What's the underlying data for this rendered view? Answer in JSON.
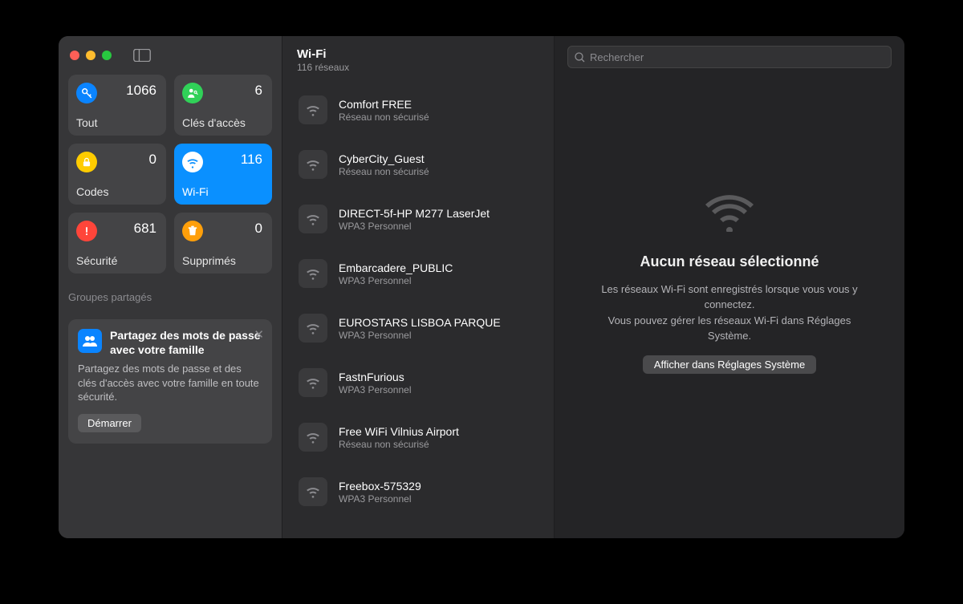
{
  "sidebar": {
    "categories": [
      {
        "label": "Tout",
        "count": "1066",
        "icon": "key",
        "color": "#0a84ff"
      },
      {
        "label": "Clés d'accès",
        "count": "6",
        "icon": "person-key",
        "color": "#30d158"
      },
      {
        "label": "Codes",
        "count": "0",
        "icon": "lock",
        "color": "#ffcc00"
      },
      {
        "label": "Wi-Fi",
        "count": "116",
        "icon": "wifi",
        "color": "#ffffff",
        "selected": true
      },
      {
        "label": "Sécurité",
        "count": "681",
        "icon": "alert",
        "color": "#ff453a"
      },
      {
        "label": "Supprimés",
        "count": "0",
        "icon": "trash",
        "color": "#ff9f0a"
      }
    ],
    "shared_section_label": "Groupes partagés",
    "share_card": {
      "title": "Partagez des mots de passe avec votre famille",
      "body": "Partagez des mots de passe et des clés d'accès avec votre famille en toute sécurité.",
      "button": "Démarrer"
    }
  },
  "middle": {
    "title": "Wi-Fi",
    "subtitle": "116 réseaux",
    "networks": [
      {
        "name": "Comfort FREE",
        "security": "Réseau non sécurisé"
      },
      {
        "name": "CyberCity_Guest",
        "security": "Réseau non sécurisé"
      },
      {
        "name": "DIRECT-5f-HP M277 LaserJet",
        "security": "WPA3 Personnel"
      },
      {
        "name": "Embarcadere_PUBLIC",
        "security": "WPA3 Personnel"
      },
      {
        "name": "EUROSTARS LISBOA PARQUE",
        "security": "WPA3 Personnel"
      },
      {
        "name": "FastnFurious",
        "security": "WPA3 Personnel"
      },
      {
        "name": "Free WiFi Vilnius Airport",
        "security": "Réseau non sécurisé"
      },
      {
        "name": "Freebox-575329",
        "security": "WPA3 Personnel"
      }
    ]
  },
  "detail": {
    "search_placeholder": "Rechercher",
    "title": "Aucun réseau sélectionné",
    "line1": "Les réseaux Wi-Fi sont enregistrés lorsque vous vous y connectez.",
    "line2": "Vous pouvez gérer les réseaux Wi-Fi dans Réglages Système.",
    "button": "Afficher dans Réglages Système"
  }
}
